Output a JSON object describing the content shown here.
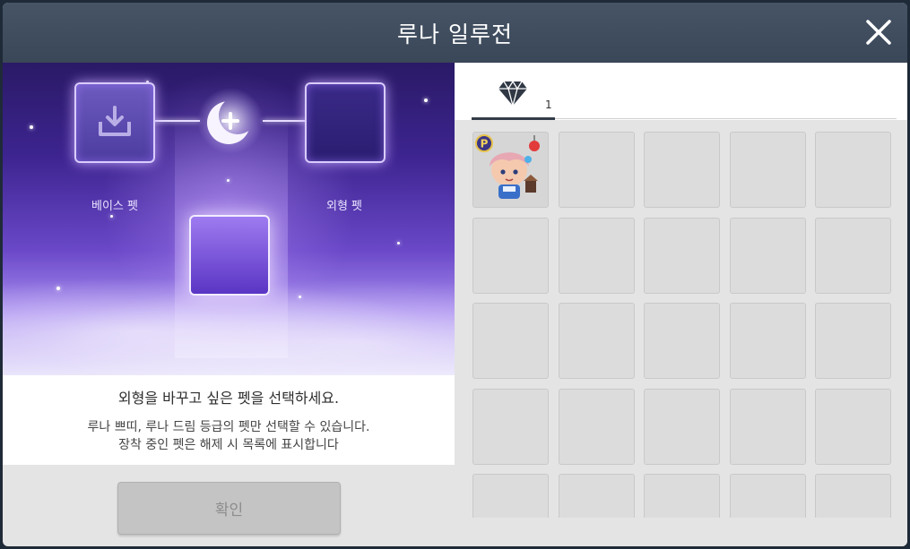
{
  "window": {
    "title": "루나 일루전"
  },
  "stage": {
    "base_label": "베이스 펫",
    "skin_label": "외형 펫"
  },
  "info": {
    "message": "외형을 바꾸고 싶은 펫을 선택하세요.",
    "note_line1": "루나 쁘띠, 루나 드림 등급의 펫만 선택할 수 있습니다.",
    "note_line2": "장착 중인 펫은 해제 시 목록에 표시합니다"
  },
  "buttons": {
    "confirm_label": "확인"
  },
  "tabs": [
    {
      "icon": "diamond-icon",
      "count": "1"
    }
  ],
  "inventory": {
    "items": [
      {
        "icon": "pet-character-icon",
        "badge": "P"
      }
    ]
  },
  "colors": {
    "titlebar": "#465466",
    "accent_purple": "#6a48c8",
    "button_disabled": "#c4c4c4"
  }
}
